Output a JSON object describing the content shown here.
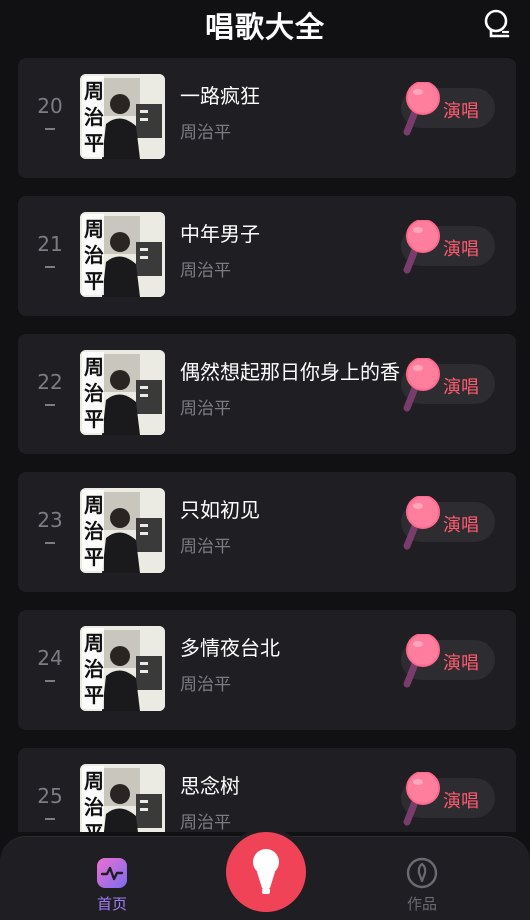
{
  "header": {
    "title": "唱歌大全",
    "user_icon": "user-profile-icon"
  },
  "songs": [
    {
      "rank": "20",
      "title": "一路疯狂",
      "singer": "周治平",
      "action": "演唱"
    },
    {
      "rank": "21",
      "title": "中年男子",
      "singer": "周治平",
      "action": "演唱"
    },
    {
      "rank": "22",
      "title": "偶然想起那日你身上的香",
      "singer": "周治平",
      "action": "演唱"
    },
    {
      "rank": "23",
      "title": "只如初见",
      "singer": "周治平",
      "action": "演唱"
    },
    {
      "rank": "24",
      "title": "多情夜台北",
      "singer": "周治平",
      "action": "演唱"
    },
    {
      "rank": "25",
      "title": "思念树",
      "singer": "周治平",
      "action": "演唱"
    }
  ],
  "cover_text": "周治平",
  "tabbar": {
    "home_label": "首页",
    "works_label": "作品",
    "center": "microphone-icon"
  },
  "colors": {
    "accent": "#f04358",
    "sing_text": "#ff5a6e",
    "active_tab": "#a37ef4",
    "card_bg": "#1f1f23"
  }
}
